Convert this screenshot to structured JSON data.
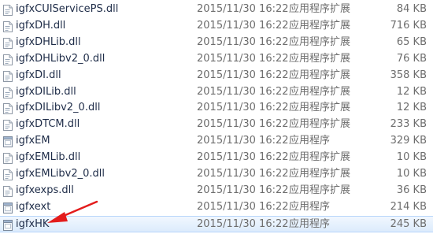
{
  "files": [
    {
      "name": "igfxCUIServicePS.dll",
      "date": "2015/11/30 16:22",
      "type": "应用程序扩展",
      "size": "84 KB",
      "icon": "dll-file-icon"
    },
    {
      "name": "igfxDH.dll",
      "date": "2015/11/30 16:22",
      "type": "应用程序扩展",
      "size": "716 KB",
      "icon": "dll-file-icon"
    },
    {
      "name": "igfxDHLib.dll",
      "date": "2015/11/30 16:22",
      "type": "应用程序扩展",
      "size": "65 KB",
      "icon": "dll-file-icon"
    },
    {
      "name": "igfxDHLibv2_0.dll",
      "date": "2015/11/30 16:22",
      "type": "应用程序扩展",
      "size": "76 KB",
      "icon": "dll-file-icon"
    },
    {
      "name": "igfxDI.dll",
      "date": "2015/11/30 16:22",
      "type": "应用程序扩展",
      "size": "358 KB",
      "icon": "dll-file-icon"
    },
    {
      "name": "igfxDILib.dll",
      "date": "2015/11/30 16:22",
      "type": "应用程序扩展",
      "size": "12 KB",
      "icon": "dll-file-icon"
    },
    {
      "name": "igfxDILibv2_0.dll",
      "date": "2015/11/30 16:22",
      "type": "应用程序扩展",
      "size": "12 KB",
      "icon": "dll-file-icon"
    },
    {
      "name": "igfxDTCM.dll",
      "date": "2015/11/30 16:22",
      "type": "应用程序扩展",
      "size": "233 KB",
      "icon": "dll-file-icon"
    },
    {
      "name": "igfxEM",
      "date": "2015/11/30 16:22",
      "type": "应用程序",
      "size": "329 KB",
      "icon": "exe-file-icon"
    },
    {
      "name": "igfxEMLib.dll",
      "date": "2015/11/30 16:22",
      "type": "应用程序扩展",
      "size": "10 KB",
      "icon": "dll-file-icon"
    },
    {
      "name": "igfxEMLibv2_0.dll",
      "date": "2015/11/30 16:22",
      "type": "应用程序扩展",
      "size": "10 KB",
      "icon": "dll-file-icon"
    },
    {
      "name": "igfxexps.dll",
      "date": "2015/11/30 16:22",
      "type": "应用程序扩展",
      "size": "36 KB",
      "icon": "dll-file-icon"
    },
    {
      "name": "igfxext",
      "date": "2015/11/30 16:22",
      "type": "应用程序",
      "size": "214 KB",
      "icon": "exe-file-icon"
    },
    {
      "name": "igfxHK",
      "date": "2015/11/30 16:22",
      "type": "应用程序",
      "size": "245 KB",
      "icon": "exe-file-icon",
      "selected": true
    }
  ],
  "colors": {
    "selection_background": "#dcebfc",
    "selection_border": "#b8d6fb",
    "arrow": "#e31c1c",
    "name_text": "#1e2c48",
    "detail_text": "#6d6d6d"
  },
  "annotation": {
    "icon": "red-arrow-icon",
    "points_to": "igfxHK"
  }
}
